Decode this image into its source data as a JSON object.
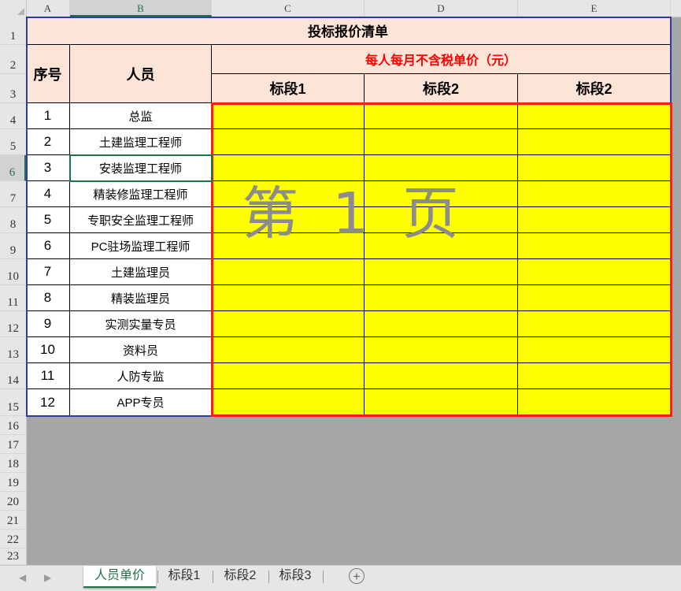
{
  "columns": [
    "A",
    "B",
    "C",
    "D",
    "E"
  ],
  "rows": [
    "1",
    "2",
    "3",
    "4",
    "5",
    "6",
    "7",
    "8",
    "9",
    "10",
    "11",
    "12",
    "13",
    "14",
    "15",
    "16",
    "17",
    "18",
    "19",
    "20",
    "21",
    "22",
    "23"
  ],
  "table": {
    "title": "投标报价清单",
    "seq_header": "序号",
    "person_header": "人员",
    "price_header": "每人每月不含税单价（元）",
    "segment_headers": [
      "标段1",
      "标段2",
      "标段2"
    ],
    "body": [
      {
        "no": "1",
        "person": "总监"
      },
      {
        "no": "2",
        "person": "土建监理工程师"
      },
      {
        "no": "3",
        "person": "安装监理工程师"
      },
      {
        "no": "4",
        "person": "精装修监理工程师"
      },
      {
        "no": "5",
        "person": "专职安全监理工程师"
      },
      {
        "no": "6",
        "person": "PC驻场监理工程师"
      },
      {
        "no": "7",
        "person": "土建监理员"
      },
      {
        "no": "8",
        "person": "精装监理员"
      },
      {
        "no": "9",
        "person": "实测实量专员"
      },
      {
        "no": "10",
        "person": "资料员"
      },
      {
        "no": "11",
        "person": "人防专监"
      },
      {
        "no": "12",
        "person": "APP专员"
      }
    ]
  },
  "watermark": "第 1 页",
  "sheet_tabs": [
    "人员单价",
    "标段1",
    "标段2",
    "标段3"
  ],
  "active_sheet": "人员单价",
  "selected_cell": "B6",
  "colors": {
    "header_fill": "#fce4d6",
    "input_fill": "#ffff00",
    "price_header_text": "#ff0000",
    "excel_green": "#217346"
  }
}
